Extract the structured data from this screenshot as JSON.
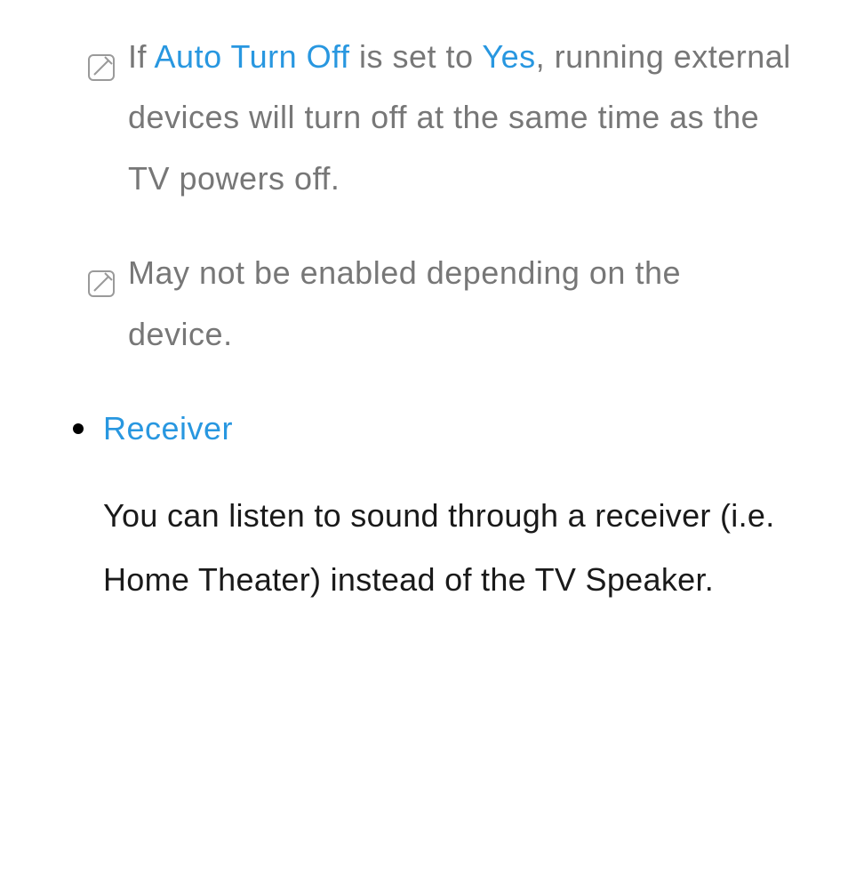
{
  "note1": {
    "pre": "If ",
    "hl1": "Auto Turn Off",
    "mid": " is set to ",
    "hl2": "Yes",
    "post": ", running external devices will turn off at the same time as the TV powers off."
  },
  "note2": "May not be enabled depending on the device.",
  "section_title": "Receiver",
  "section_body": "You can listen to sound through a receiver (i.e. Home Theater) instead of the TV Speaker."
}
